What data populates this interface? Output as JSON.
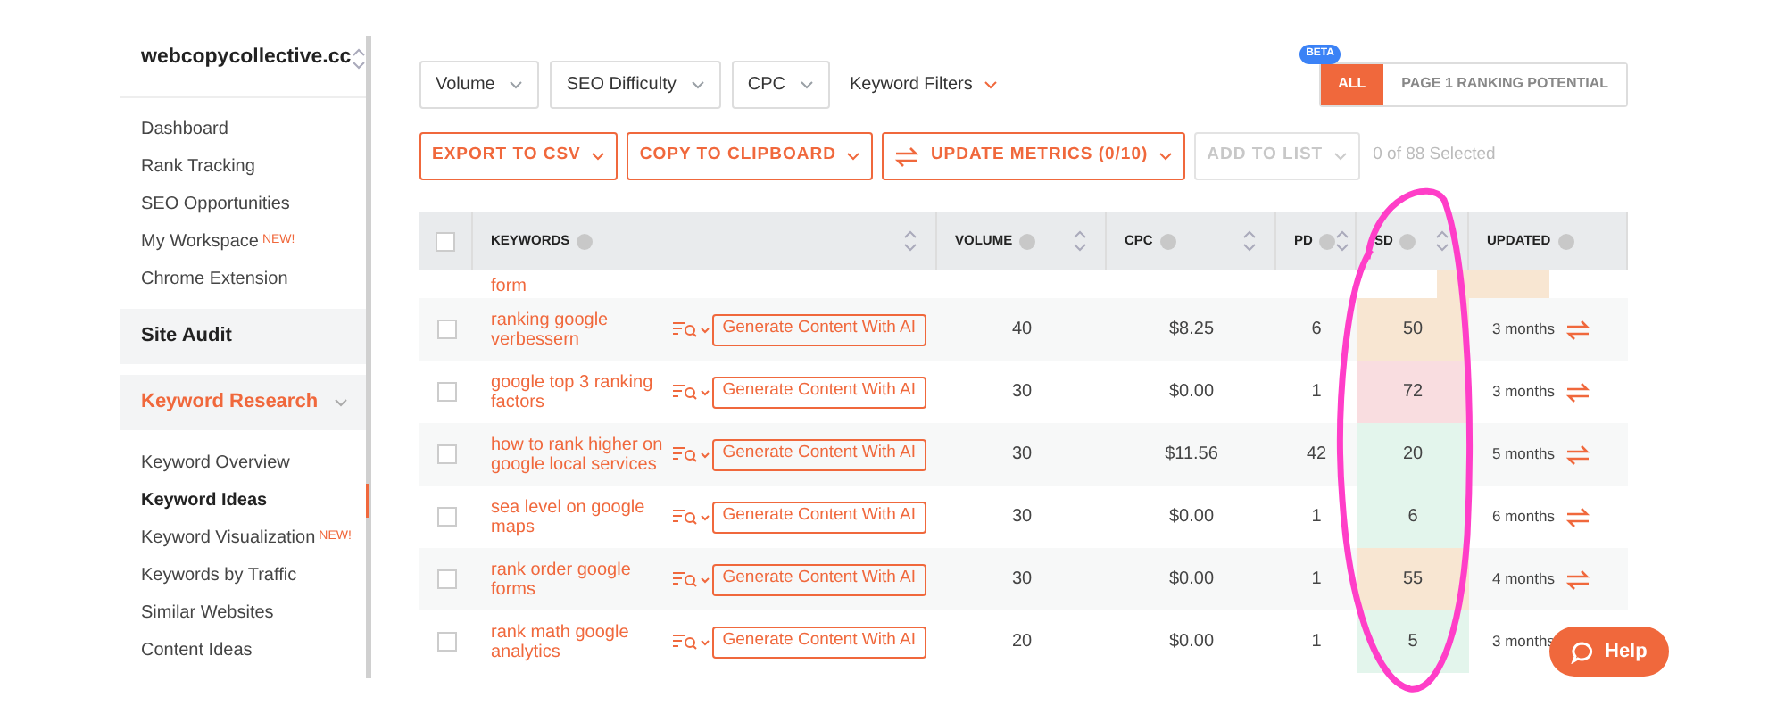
{
  "sidebar": {
    "site": "webcopycollective.cc",
    "items": [
      {
        "kind": "link",
        "label": "Dashboard",
        "selected": false
      },
      {
        "kind": "link",
        "label": "Rank Tracking",
        "selected": false
      },
      {
        "kind": "link",
        "label": "SEO Opportunities",
        "selected": false
      },
      {
        "kind": "link",
        "label": "My Workspace",
        "badge": "NEW!",
        "selected": false
      },
      {
        "kind": "link",
        "label": "Chrome Extension",
        "selected": false
      },
      {
        "kind": "section",
        "label": "Site Audit",
        "selected": false
      },
      {
        "kind": "section",
        "label": "Keyword Research",
        "selected": true,
        "expanded": true,
        "children": [
          {
            "kind": "link",
            "label": "Keyword Overview",
            "selected": false
          },
          {
            "kind": "link",
            "label": "Keyword Ideas",
            "selected": true
          },
          {
            "kind": "link",
            "label": "Keyword Visualization",
            "badge": "NEW!",
            "selected": false
          },
          {
            "kind": "link",
            "label": "Keywords by Traffic",
            "selected": false
          },
          {
            "kind": "link",
            "label": "Similar Websites",
            "selected": false
          },
          {
            "kind": "link",
            "label": "Content Ideas",
            "selected": false
          }
        ]
      }
    ]
  },
  "filters": [
    "Volume",
    "SEO Difficulty",
    "CPC"
  ],
  "keyword_filters": "Keyword Filters",
  "view_toggle": [
    {
      "label": "ALL",
      "badge": "BETA",
      "selected": true
    },
    {
      "label": "PAGE 1 RANKING POTENTIAL",
      "selected": false
    }
  ],
  "actions": [
    {
      "label": "EXPORT TO CSV",
      "disabled": false
    },
    {
      "label": "COPY TO CLIPBOARD",
      "disabled": false
    },
    {
      "label": "UPDATE METRICS (0/10)",
      "disabled": false,
      "refresh_icon": true
    },
    {
      "label": "ADD TO LIST",
      "disabled": true
    }
  ],
  "selection_count": "0 of 88 Selected",
  "table": {
    "columns": [
      {
        "label": "KEYWORDS",
        "sortable": true
      },
      {
        "label": "VOLUME",
        "sortable": true
      },
      {
        "label": "CPC",
        "sortable": true
      },
      {
        "label": "PD",
        "sortable": true
      },
      {
        "label": "SD",
        "sortable": true
      },
      {
        "label": "UPDATED",
        "sortable": false
      }
    ],
    "select_all_checked": false,
    "partial_row": {
      "keyword": "form",
      "color": "#f8e6d2"
    },
    "rows": [
      {
        "keyword": "ranking google verbessern",
        "action": "Generate Content With AI",
        "volume": "40",
        "cpc": "$8.25",
        "pd": "6",
        "sd": "50",
        "color": "#f8e6d2",
        "checked": false,
        "updated": "3 months"
      },
      {
        "keyword": "google top 3 ranking factors",
        "action": "Generate Content With AI",
        "volume": "30",
        "cpc": "$0.00",
        "pd": "1",
        "sd": "72",
        "color": "#f9dde0",
        "checked": false,
        "updated": "3 months"
      },
      {
        "keyword": "how to rank higher on google local services",
        "action": "Generate Content With AI",
        "volume": "30",
        "cpc": "$11.56",
        "pd": "42",
        "sd": "20",
        "color": "#e3f5ec",
        "checked": false,
        "updated": "5 months"
      },
      {
        "keyword": "sea level on google maps",
        "action": "Generate Content With AI",
        "volume": "30",
        "cpc": "$0.00",
        "pd": "1",
        "sd": "6",
        "color": "#e3f5ec",
        "checked": false,
        "updated": "6 months"
      },
      {
        "keyword": "rank order google forms",
        "action": "Generate Content With AI",
        "volume": "30",
        "cpc": "$0.00",
        "pd": "1",
        "sd": "55",
        "color": "#f8e6d2",
        "checked": false,
        "updated": "4 months"
      },
      {
        "keyword": "rank math google analytics",
        "action": "Generate Content With AI",
        "volume": "20",
        "cpc": "$0.00",
        "pd": "1",
        "sd": "5",
        "color": "#e3f5ec",
        "checked": false,
        "updated": "3 months"
      }
    ]
  },
  "help_button": "Help"
}
